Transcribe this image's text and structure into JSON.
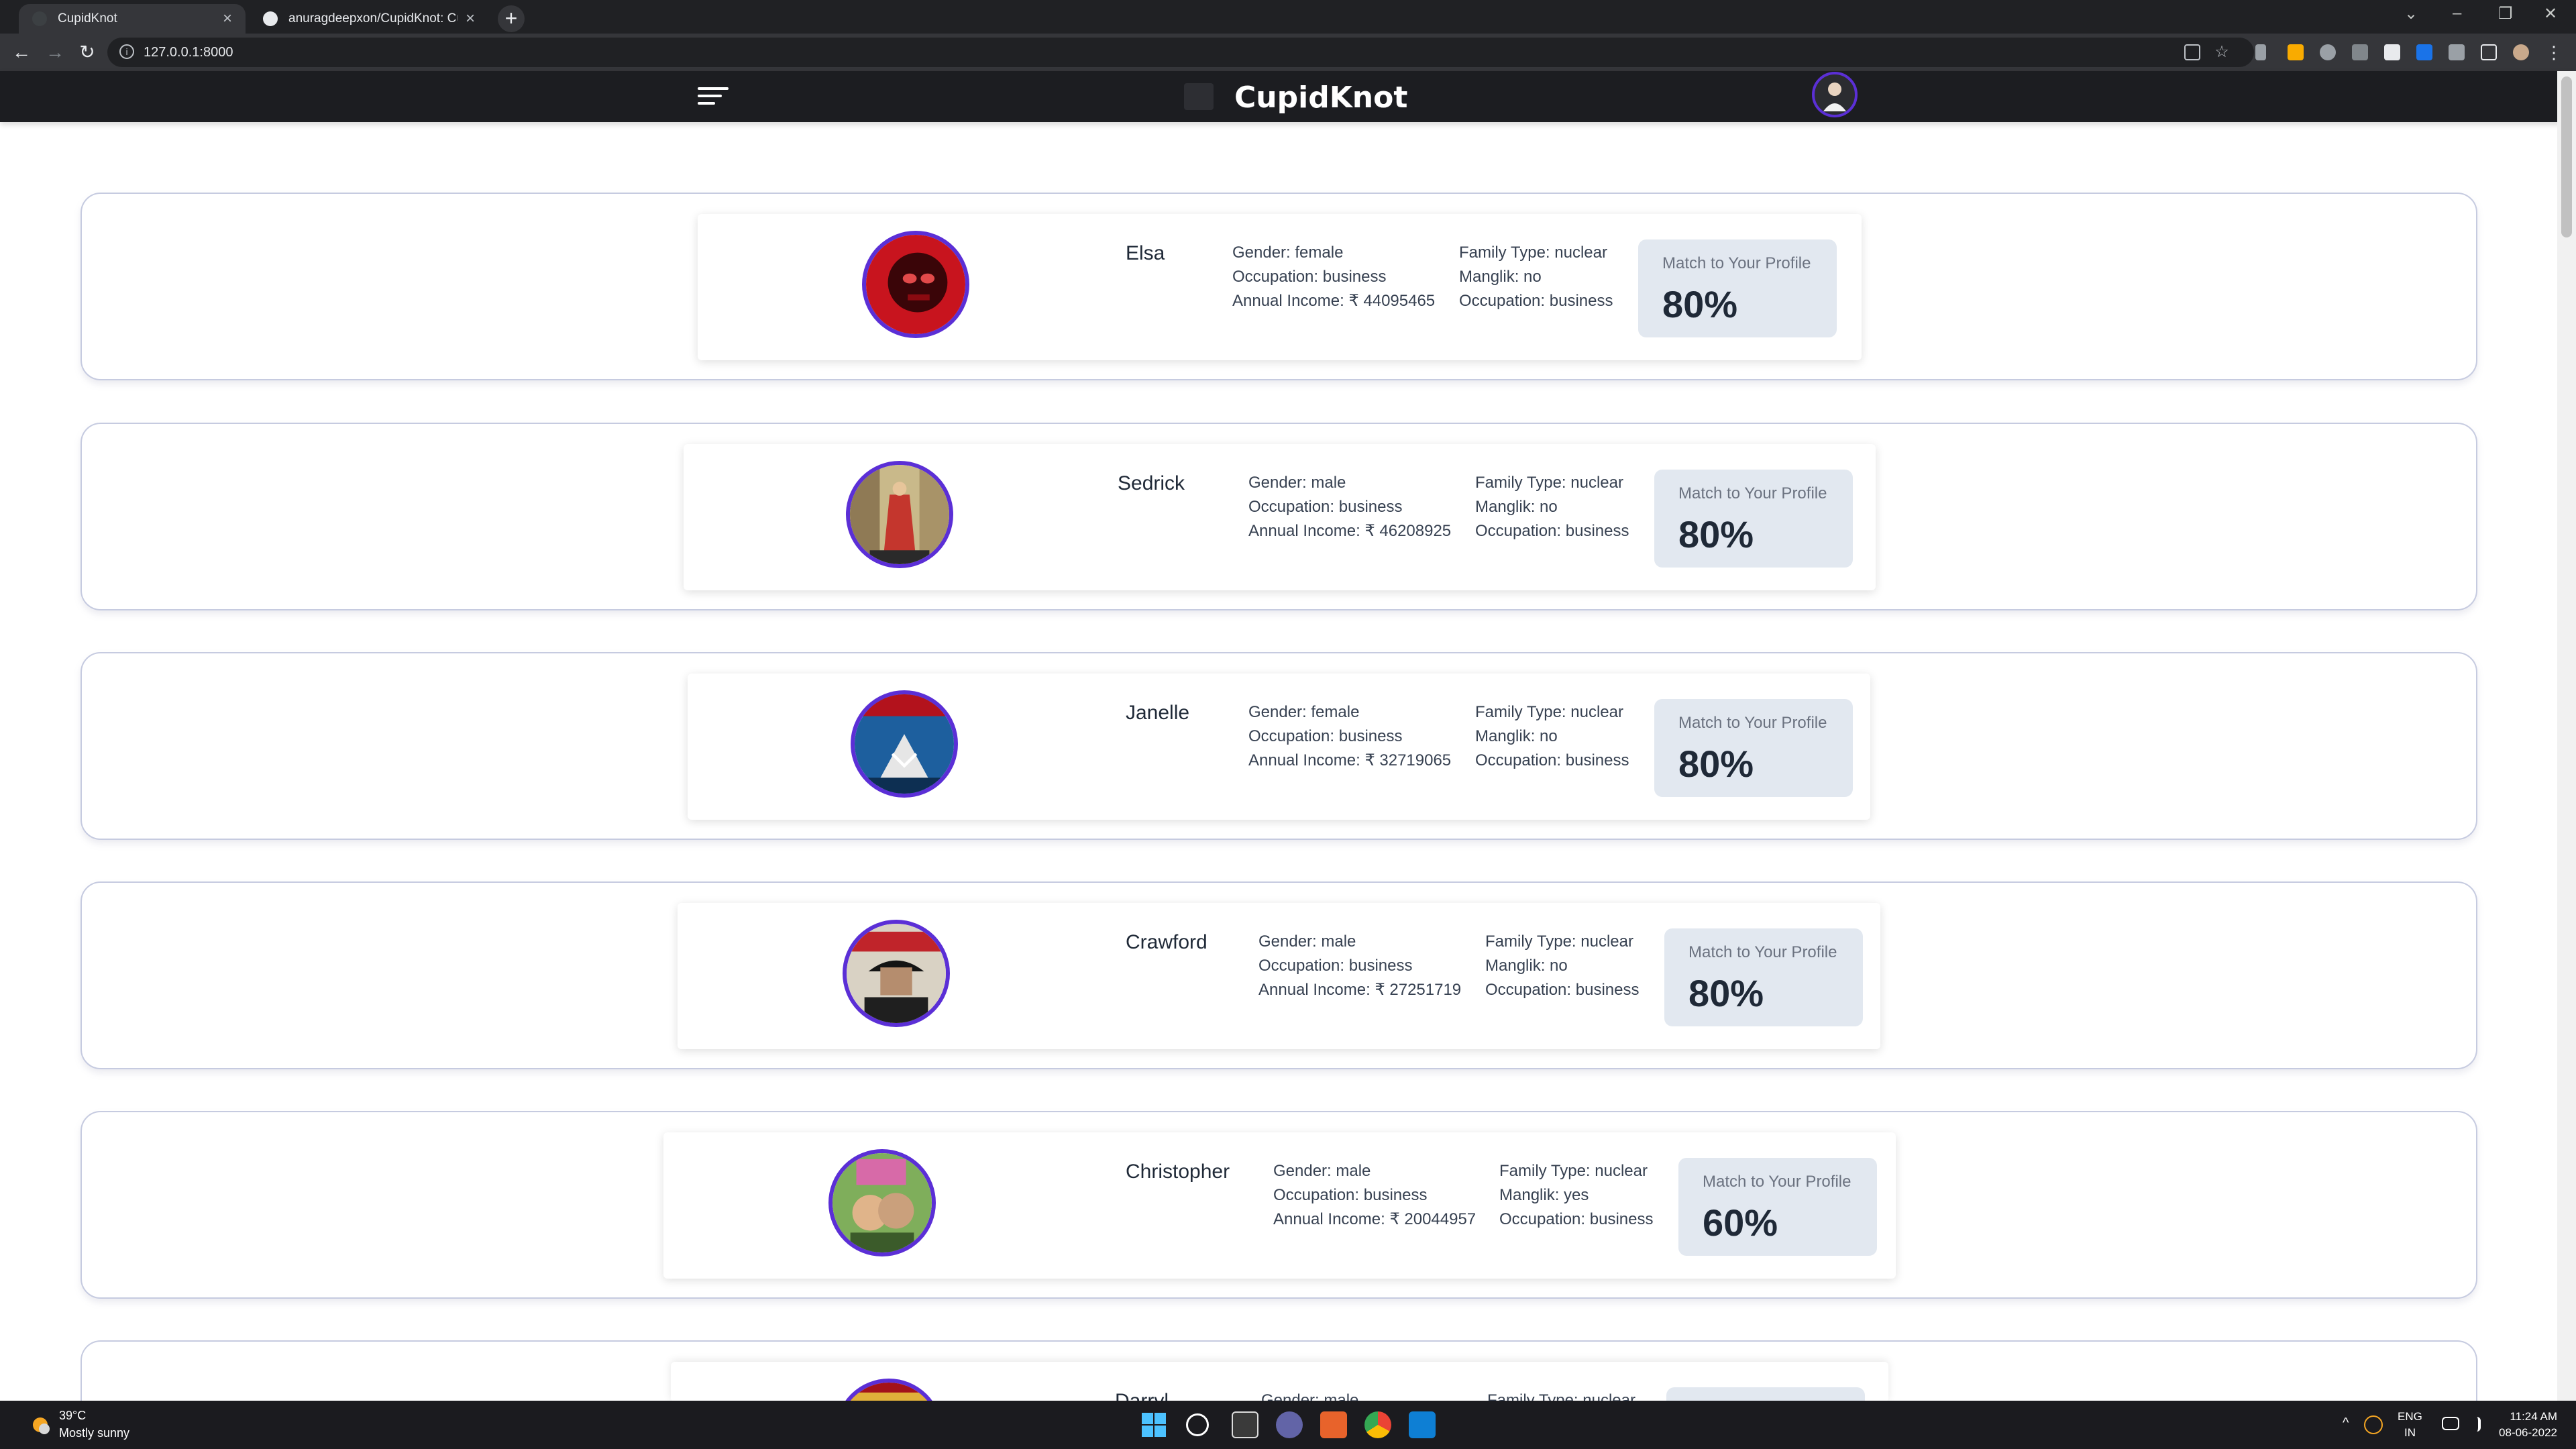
{
  "browser": {
    "tabs": [
      {
        "title": "CupidKnot"
      },
      {
        "title": "anuragdeepxon/CupidKnot: Cup"
      }
    ],
    "url": "127.0.0.1:8000"
  },
  "header": {
    "brand": "CupidKnot"
  },
  "profiles": [
    {
      "name": "Elsa",
      "gender": "Gender: female",
      "occupation": "Occupation: business",
      "income": "Annual Income: ₹ 44095465",
      "family": "Family Type: nuclear",
      "manglik": "Manglik: no",
      "occupation2": "Occupation: business",
      "match_label": "Match to Your Profile",
      "match": "80%"
    },
    {
      "name": "Sedrick",
      "gender": "Gender: male",
      "occupation": "Occupation: business",
      "income": "Annual Income: ₹ 46208925",
      "family": "Family Type: nuclear",
      "manglik": "Manglik: no",
      "occupation2": "Occupation: business",
      "match_label": "Match to Your Profile",
      "match": "80%"
    },
    {
      "name": "Janelle",
      "gender": "Gender: female",
      "occupation": "Occupation: business",
      "income": "Annual Income: ₹ 32719065",
      "family": "Family Type: nuclear",
      "manglik": "Manglik: no",
      "occupation2": "Occupation: business",
      "match_label": "Match to Your Profile",
      "match": "80%"
    },
    {
      "name": "Crawford",
      "gender": "Gender: male",
      "occupation": "Occupation: business",
      "income": "Annual Income: ₹ 27251719",
      "family": "Family Type: nuclear",
      "manglik": "Manglik: no",
      "occupation2": "Occupation: business",
      "match_label": "Match to Your Profile",
      "match": "80%"
    },
    {
      "name": "Christopher",
      "gender": "Gender: male",
      "occupation": "Occupation: business",
      "income": "Annual Income: ₹ 20044957",
      "family": "Family Type: nuclear",
      "manglik": "Manglik: yes",
      "occupation2": "Occupation: business",
      "match_label": "Match to Your Profile",
      "match": "60%"
    },
    {
      "name": "Darryl",
      "gender": "Gender: male",
      "occupation": "",
      "income": "",
      "family": "Family Type: nuclear",
      "manglik": "",
      "occupation2": "",
      "match_label": "",
      "match": ""
    }
  ],
  "taskbar": {
    "temp": "39°C",
    "weather": "Mostly sunny",
    "lang1": "ENG",
    "lang2": "IN",
    "time": "11:24 AM",
    "date": "08-06-2022"
  }
}
